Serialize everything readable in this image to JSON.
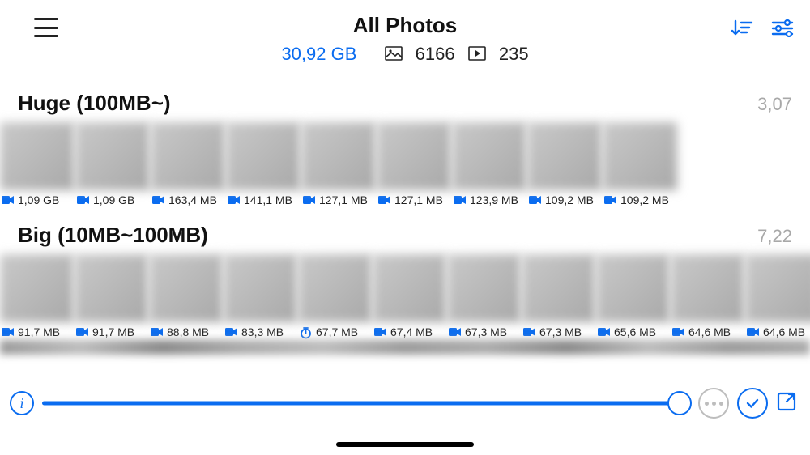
{
  "header": {
    "title": "All Photos",
    "total_size": "30,92 GB",
    "photo_count": "6166",
    "video_count": "235"
  },
  "sections": [
    {
      "title": "Huge (100MB~)",
      "meta": "3,07",
      "items": [
        {
          "size": "1,09 GB",
          "icon": "video"
        },
        {
          "size": "1,09 GB",
          "icon": "video"
        },
        {
          "size": "163,4 MB",
          "icon": "video"
        },
        {
          "size": "141,1 MB",
          "icon": "video"
        },
        {
          "size": "127,1 MB",
          "icon": "video"
        },
        {
          "size": "127,1 MB",
          "icon": "video"
        },
        {
          "size": "123,9 MB",
          "icon": "video"
        },
        {
          "size": "109,2 MB",
          "icon": "video"
        },
        {
          "size": "109,2 MB",
          "icon": "video"
        }
      ]
    },
    {
      "title": "Big (10MB~100MB)",
      "meta": "7,22",
      "items": [
        {
          "size": "91,7 MB",
          "icon": "video"
        },
        {
          "size": "91,7 MB",
          "icon": "video"
        },
        {
          "size": "88,8 MB",
          "icon": "video"
        },
        {
          "size": "83,3 MB",
          "icon": "video"
        },
        {
          "size": "67,7 MB",
          "icon": "timer"
        },
        {
          "size": "67,4 MB",
          "icon": "video"
        },
        {
          "size": "67,3 MB",
          "icon": "video"
        },
        {
          "size": "67,3 MB",
          "icon": "video"
        },
        {
          "size": "65,6 MB",
          "icon": "video"
        },
        {
          "size": "64,6 MB",
          "icon": "video"
        },
        {
          "size": "64,6 MB",
          "icon": "video"
        }
      ]
    }
  ],
  "colors": {
    "accent": "#0a6cf0"
  }
}
